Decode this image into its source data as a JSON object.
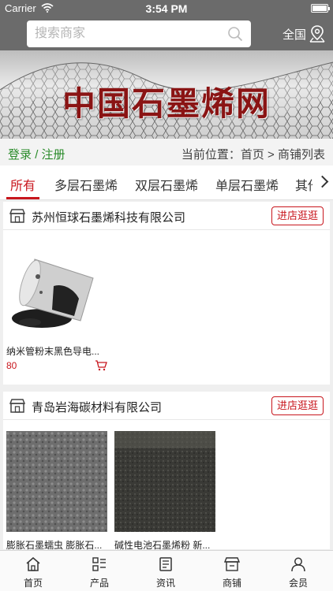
{
  "status_bar": {
    "carrier": "Carrier",
    "time": "3:54 PM"
  },
  "search": {
    "placeholder": "搜索商家",
    "region_label": "全国"
  },
  "banner": {
    "title": "中国石墨烯网"
  },
  "login_bar": {
    "login": "登录",
    "separator": "/",
    "register": "注册",
    "breadcrumb": "当前位置：首页 > 商铺列表"
  },
  "tabs": [
    {
      "label": "所有",
      "active": true
    },
    {
      "label": "多层石墨烯",
      "active": false
    },
    {
      "label": "双层石墨烯",
      "active": false
    },
    {
      "label": "单层石墨烯",
      "active": false
    },
    {
      "label": "其他",
      "active": false
    }
  ],
  "shops": [
    {
      "name": "苏州恒球石墨烯科技有限公司",
      "enter_label": "进店逛逛",
      "products": [
        {
          "name": "纳米管粉末黑色导电...",
          "price": "80"
        }
      ]
    },
    {
      "name": "青岛岩海碳材料有限公司",
      "enter_label": "进店逛逛",
      "products": [
        {
          "name": "膨胀石墨蠕虫 膨胀石...",
          "price": ""
        },
        {
          "name": "碱性电池石墨烯粉 新...",
          "price": ""
        }
      ]
    }
  ],
  "bottom_nav": [
    {
      "label": "首页",
      "icon": "home-icon"
    },
    {
      "label": "产品",
      "icon": "product-list-icon"
    },
    {
      "label": "资讯",
      "icon": "news-icon"
    },
    {
      "label": "商铺",
      "icon": "shop-icon"
    },
    {
      "label": "会员",
      "icon": "user-icon"
    }
  ],
  "colors": {
    "accent": "#c8161d",
    "header_bg": "#6b6b6b",
    "login_green": "#2a8b2a"
  }
}
